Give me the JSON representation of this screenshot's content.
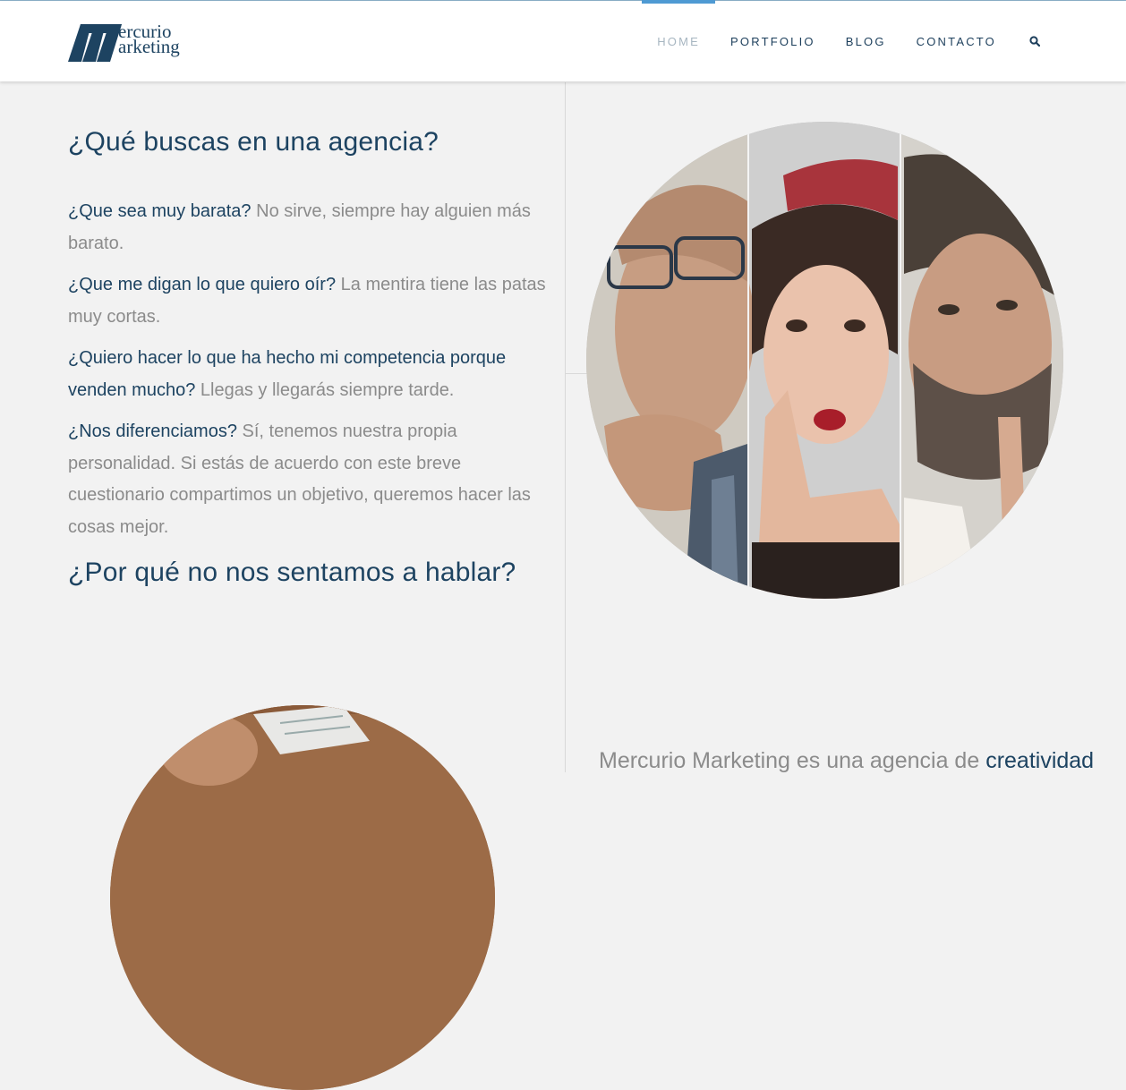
{
  "brand": {
    "logo_line1": "ercurio",
    "logo_line2": "arketing"
  },
  "nav": {
    "items": [
      {
        "label": "HOME",
        "active": true
      },
      {
        "label": "PORTFOLIO"
      },
      {
        "label": "BLOG"
      },
      {
        "label": "CONTACTO"
      }
    ],
    "search_icon": "search-icon"
  },
  "content": {
    "heading": "¿Qué buscas en una agencia?",
    "paragraphs": [
      {
        "q": "¿Que sea muy barata?",
        "rest": "No sirve, siempre hay alguien más barato."
      },
      {
        "q": "¿Que me digan lo que quiero oír?",
        "rest": "La mentira tiene las patas muy cortas."
      },
      {
        "q": "¿Quiero hacer lo que ha hecho mi competencia porque venden mucho?",
        "rest": "Llegas y llegarás siempre tarde."
      },
      {
        "q": "¿Nos diferenciamos?",
        "rest": "Sí, tenemos nuestra propia personalidad. Si estás de acuerdo con este breve cuestionario compartimos un objetivo, queremos hacer las cosas mejor."
      }
    ],
    "cta_heading": "¿Por qué no nos sentamos a hablar?"
  },
  "bottom": {
    "text": "Mercurio Marketing es una agencia de",
    "highlight": "creatividad"
  },
  "colors": {
    "accent": "#4e9ad3",
    "brand": "#1d4361",
    "body_text": "#8b8b8b",
    "background": "#f2f2f2"
  }
}
